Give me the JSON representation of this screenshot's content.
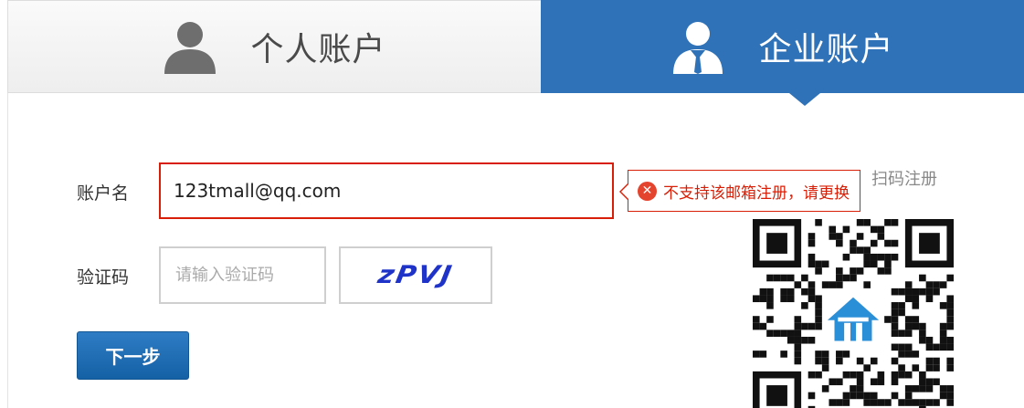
{
  "tabs": {
    "personal": {
      "label": "个人账户",
      "icon": "person-icon",
      "active": false
    },
    "business": {
      "label": "企业账户",
      "icon": "business-person-icon",
      "active": true
    }
  },
  "form": {
    "account_label": "账户名",
    "account_value": "123tmall@qq.com",
    "error_message": "不支持该邮箱注册，请更换",
    "captcha_label": "验证码",
    "captcha_placeholder": "请输入验证码",
    "captcha_code": "zPVJ",
    "next_button": "下一步"
  },
  "qr": {
    "caption": "扫码注册",
    "icon": "house-logo-icon"
  },
  "colors": {
    "active_tab": "#2f72b8",
    "error": "#d81e06",
    "button": "#1a68ae",
    "captcha_text": "#1f33c8"
  }
}
